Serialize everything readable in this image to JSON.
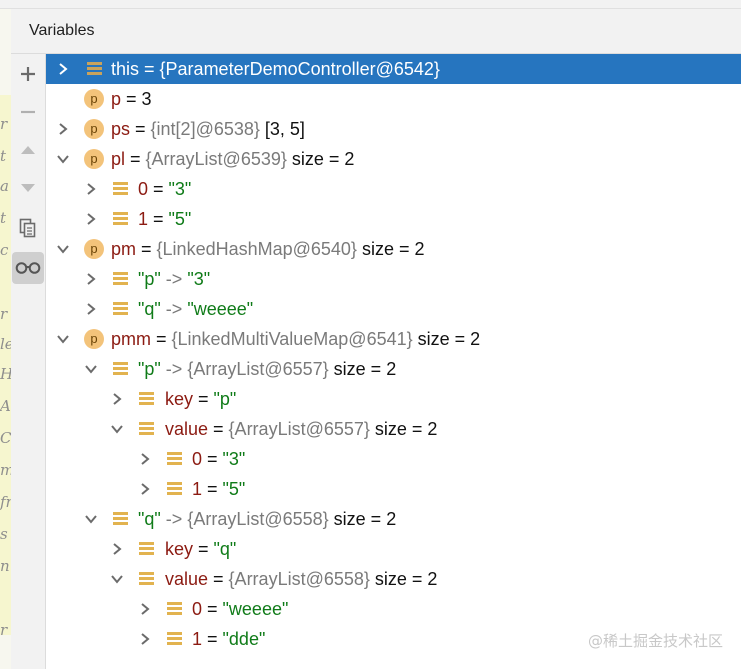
{
  "header": {
    "title": "Variables"
  },
  "left_glyphs": [
    "r",
    "t",
    "a",
    "t",
    "c",
    "r",
    "le",
    "H",
    "A",
    "C",
    "m",
    "fr",
    "s",
    "n",
    "r"
  ],
  "toolbar": {
    "buttons": [
      {
        "icon": "plus-icon"
      },
      {
        "icon": "minus-icon"
      },
      {
        "icon": "up-arrow-icon"
      },
      {
        "icon": "down-arrow-icon"
      },
      {
        "icon": "copy-icon"
      },
      {
        "icon": "glasses-icon"
      }
    ]
  },
  "variables": [
    {
      "name": "this",
      "sep": " = ",
      "type": "{ParameterDemoController@6542}",
      "extra": "",
      "value": ""
    },
    {
      "name": "p",
      "sep": " = ",
      "type": "",
      "extra": "",
      "value": "3"
    },
    {
      "name": "ps",
      "sep": " = ",
      "type": "{int[2]@6538}",
      "extra": " [3, 5]",
      "value": ""
    },
    {
      "name": "pl",
      "sep": " = ",
      "type": "{ArrayList@6539}",
      "extra": "  size = 2",
      "value": ""
    },
    {
      "name": "0",
      "sep": " = ",
      "type": "",
      "extra": "",
      "value": "\"3\""
    },
    {
      "name": "1",
      "sep": " = ",
      "type": "",
      "extra": "",
      "value": "\"5\""
    },
    {
      "name": "pm",
      "sep": " = ",
      "type": "{LinkedHashMap@6540}",
      "extra": "  size = 2",
      "value": ""
    },
    {
      "name": "\"p\"",
      "sep": " -> ",
      "type": "",
      "extra": "",
      "value": "\"3\""
    },
    {
      "name": "\"q\"",
      "sep": " -> ",
      "type": "",
      "extra": "",
      "value": "\"weeee\""
    },
    {
      "name": "pmm",
      "sep": " = ",
      "type": "{LinkedMultiValueMap@6541}",
      "extra": "  size = 2",
      "value": ""
    },
    {
      "name": "\"p\"",
      "sep": " -> ",
      "type": "{ArrayList@6557}",
      "extra": "  size = 2",
      "value": ""
    },
    {
      "name": "key",
      "sep": " = ",
      "type": "",
      "extra": "",
      "value": "\"p\""
    },
    {
      "name": "value",
      "sep": " = ",
      "type": "{ArrayList@6557}",
      "extra": "  size = 2",
      "value": ""
    },
    {
      "name": "0",
      "sep": " = ",
      "type": "",
      "extra": "",
      "value": "\"3\""
    },
    {
      "name": "1",
      "sep": " = ",
      "type": "",
      "extra": "",
      "value": "\"5\""
    },
    {
      "name": "\"q\"",
      "sep": " -> ",
      "type": "{ArrayList@6558}",
      "extra": "  size = 2",
      "value": ""
    },
    {
      "name": "key",
      "sep": " = ",
      "type": "",
      "extra": "",
      "value": "\"q\""
    },
    {
      "name": "value",
      "sep": " = ",
      "type": "{ArrayList@6558}",
      "extra": "  size = 2",
      "value": ""
    },
    {
      "name": "0",
      "sep": " = ",
      "type": "",
      "extra": "",
      "value": "\"weeee\""
    },
    {
      "name": "1",
      "sep": " = ",
      "type": "",
      "extra": "",
      "value": "\"dde\""
    }
  ],
  "watermark": "@稀土掘金技术社区",
  "colors": {
    "selected": "#2675bf",
    "name": "#8c1b12",
    "string": "#0f7b18",
    "type": "#7a7a7a",
    "icon_orange": "#f3c37a"
  }
}
